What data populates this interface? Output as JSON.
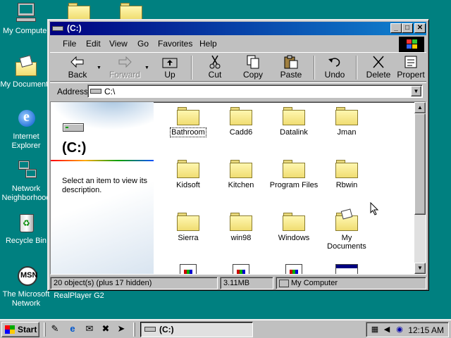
{
  "desktop": {
    "icons": [
      {
        "label": "My Computer"
      },
      {
        "label": "My Documents"
      },
      {
        "label": "Internet Explorer"
      },
      {
        "label": "Network Neighborhood"
      },
      {
        "label": "Recycle Bin"
      },
      {
        "label": "The Microsoft Network"
      },
      {
        "label": "RealPlayer G2"
      }
    ]
  },
  "window": {
    "title": "(C:)",
    "controls": {
      "minimize": "_",
      "maximize": "□",
      "close": "✕"
    }
  },
  "menu": [
    "File",
    "Edit",
    "View",
    "Go",
    "Favorites",
    "Help"
  ],
  "toolbar": {
    "back": "Back",
    "forward": "Forward",
    "up": "Up",
    "cut": "Cut",
    "copy": "Copy",
    "paste": "Paste",
    "undo": "Undo",
    "delete": "Delete",
    "properties": "Propert"
  },
  "address": {
    "label": "Address",
    "value": "C:\\"
  },
  "leftpane": {
    "title": "(C:)",
    "description": "Select an item to view its description."
  },
  "files": [
    {
      "name": "Bathroom",
      "type": "folder",
      "selected": true
    },
    {
      "name": "Cadd6",
      "type": "folder"
    },
    {
      "name": "Datalink",
      "type": "folder"
    },
    {
      "name": "Jman",
      "type": "folder"
    },
    {
      "name": "Kidsoft",
      "type": "folder"
    },
    {
      "name": "Kitchen",
      "type": "folder"
    },
    {
      "name": "Program Files",
      "type": "folder"
    },
    {
      "name": "Rbwin",
      "type": "folder"
    },
    {
      "name": "Sierra",
      "type": "folder"
    },
    {
      "name": "win98",
      "type": "folder"
    },
    {
      "name": "Windows",
      "type": "folder"
    },
    {
      "name": "My Documents",
      "type": "folder"
    }
  ],
  "status": {
    "objects": "20 object(s) (plus 17 hidden)",
    "size": "3.11MB",
    "zone": "My Computer"
  },
  "taskbar": {
    "start": "Start",
    "task": "(C:)",
    "clock": "12:15 AM"
  }
}
